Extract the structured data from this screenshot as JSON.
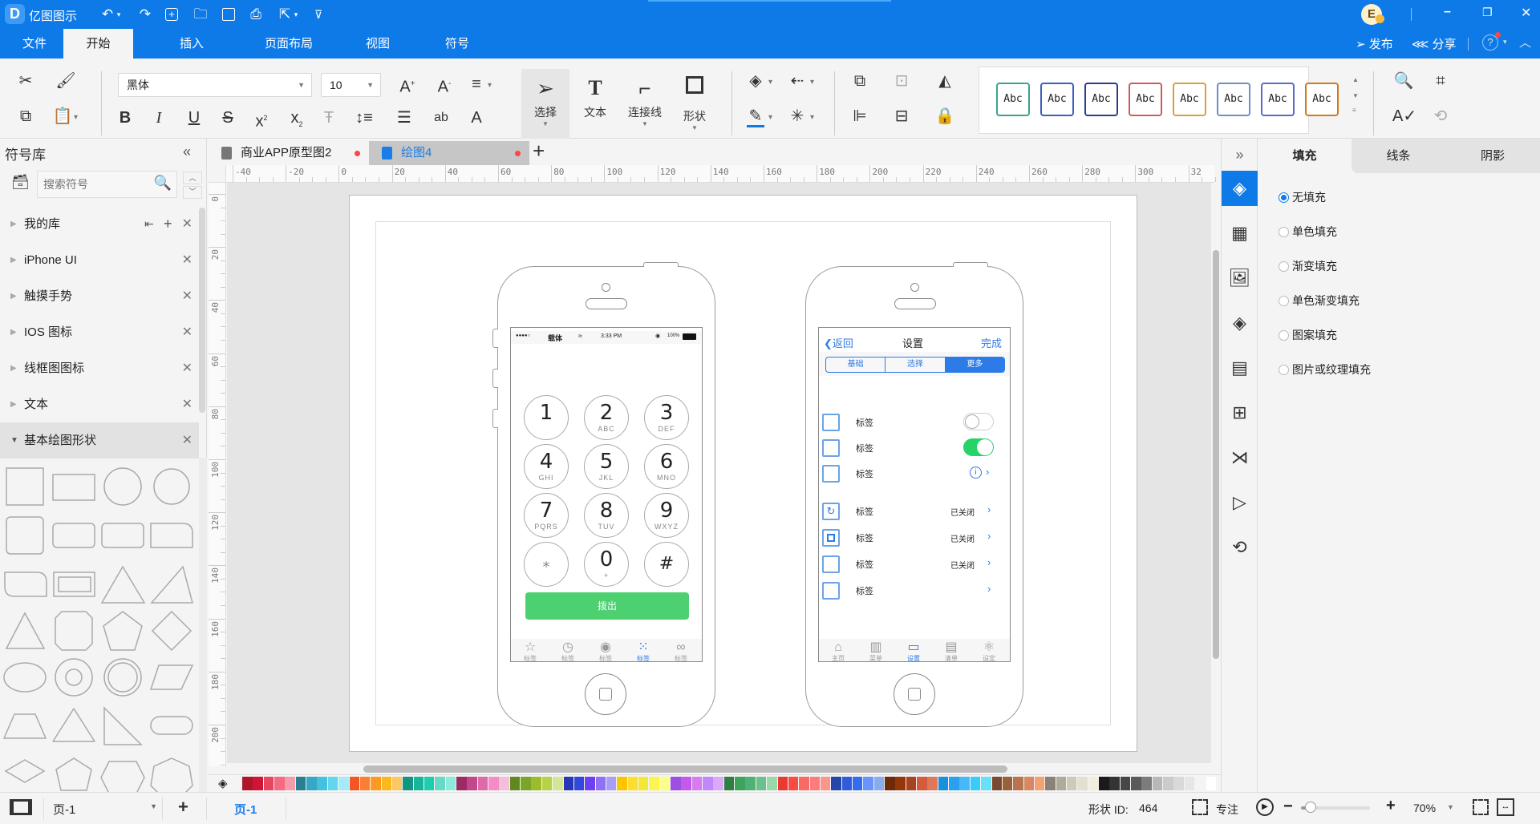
{
  "app": {
    "title": "亿图图示"
  },
  "quick_access": [
    "undo-icon",
    "redo-icon",
    "new-icon",
    "open-icon",
    "save-icon",
    "print-icon",
    "export-icon",
    "customize-icon"
  ],
  "window": {
    "avatar_letter": "E"
  },
  "menu": {
    "tabs": [
      {
        "label": "文件"
      },
      {
        "label": "开始",
        "active": true
      },
      {
        "label": "插入"
      },
      {
        "label": "页面布局"
      },
      {
        "label": "视图"
      },
      {
        "label": "符号"
      }
    ],
    "publish": "发布",
    "share": "分享"
  },
  "ribbon": {
    "font_family": "黑体",
    "font_size": "10",
    "tools": [
      {
        "label": "选择",
        "active": true
      },
      {
        "label": "文本"
      },
      {
        "label": "连接线"
      },
      {
        "label": "形状"
      }
    ],
    "style_swatch_text": "Abc",
    "style_swatches": [
      "#3aa38f",
      "#3a5fc2",
      "#2b3b8f",
      "#d05a5a",
      "#d8a23a",
      "#6b8fc8",
      "#5a6ac8",
      "#d07a1a"
    ]
  },
  "library": {
    "title": "符号库",
    "search_placeholder": "搜索符号",
    "items": [
      {
        "label": "我的库"
      },
      {
        "label": "iPhone UI"
      },
      {
        "label": "触摸手势"
      },
      {
        "label": "IOS 图标"
      },
      {
        "label": "线框图图标"
      },
      {
        "label": "文本"
      },
      {
        "label": "基本绘图形状",
        "expanded": true
      }
    ]
  },
  "doc_tabs": [
    {
      "label": "商业APP原型图2",
      "modified": true
    },
    {
      "label": "绘图4",
      "active": true,
      "modified": true
    }
  ],
  "ruler": {
    "h_ticks": [
      "-40",
      "-20",
      "0",
      "20",
      "40",
      "60",
      "80",
      "100",
      "120",
      "140",
      "160",
      "180",
      "200",
      "220",
      "240",
      "260",
      "280",
      "300",
      "32"
    ],
    "v_ticks": [
      "0",
      "20",
      "40",
      "60",
      "80",
      "100",
      "120",
      "140",
      "160",
      "180",
      "200"
    ]
  },
  "phone1": {
    "status": {
      "signal": "●●●●○",
      "carrier": "载体",
      "time": "3:33 PM",
      "battery": "100%"
    },
    "keys": [
      {
        "n": "1",
        "s": ""
      },
      {
        "n": "2",
        "s": "ABC"
      },
      {
        "n": "3",
        "s": "DEF"
      },
      {
        "n": "4",
        "s": "GHI"
      },
      {
        "n": "5",
        "s": "JKL"
      },
      {
        "n": "6",
        "s": "MNO"
      },
      {
        "n": "7",
        "s": "PQRS"
      },
      {
        "n": "8",
        "s": "TUV"
      },
      {
        "n": "9",
        "s": "WXYZ"
      },
      {
        "n": "*",
        "s": ""
      },
      {
        "n": "0",
        "s": "+"
      },
      {
        "n": "#",
        "s": ""
      }
    ],
    "call_button": "拨出",
    "call_color": "#4cd070",
    "tabbar": [
      {
        "icon": "star-icon",
        "label": "标签"
      },
      {
        "icon": "clock-icon",
        "label": "标签"
      },
      {
        "icon": "contact-icon",
        "label": "标签"
      },
      {
        "icon": "keypad-icon",
        "label": "标签",
        "active": true
      },
      {
        "icon": "voicemail-icon",
        "label": "标签"
      }
    ]
  },
  "phone2": {
    "nav": {
      "back": "返回",
      "title": "设置",
      "done": "完成"
    },
    "segments": [
      {
        "label": "基础"
      },
      {
        "label": "选择"
      },
      {
        "label": "更多",
        "active": true
      }
    ],
    "rows_a": [
      {
        "label": "标签",
        "accessory": "toggle-off"
      },
      {
        "label": "标签",
        "accessory": "toggle-on"
      },
      {
        "label": "标签",
        "accessory": "info"
      }
    ],
    "rows_b": [
      {
        "label": "标签",
        "value": "已关闭"
      },
      {
        "label": "标签",
        "value": "已关闭"
      },
      {
        "label": "标签",
        "value": "已关闭"
      },
      {
        "label": "标签",
        "value": ""
      }
    ],
    "tabbar": [
      {
        "icon": "home-icon",
        "label": "主页"
      },
      {
        "icon": "map-icon",
        "label": "菜单"
      },
      {
        "icon": "folder-icon",
        "label": "设置",
        "active": true
      },
      {
        "icon": "list-icon",
        "label": "清单"
      },
      {
        "icon": "atom-icon",
        "label": "设定"
      }
    ]
  },
  "palette": [
    "#b0162a",
    "#cf1438",
    "#e8465f",
    "#f26b82",
    "#f59bab",
    "#2a7f92",
    "#36a7c4",
    "#46c1dd",
    "#62d6ec",
    "#a8ebf8",
    "#f45426",
    "#fb7f32",
    "#fd9b20",
    "#ffb819",
    "#fcc862",
    "#129680",
    "#17b59b",
    "#20ccb0",
    "#6ad8c6",
    "#8deadc",
    "#9c2b63",
    "#c4468c",
    "#e06aa8",
    "#f58cc8",
    "#f2c0dc",
    "#62871b",
    "#7ba52a",
    "#9cbc2c",
    "#b6d24a",
    "#d5e495",
    "#2936b6",
    "#3447dc",
    "#7040f0",
    "#9070f5",
    "#a99ef5",
    "#fec400",
    "#fedd32",
    "#f1e934",
    "#fbf552",
    "#fdfd8a",
    "#9c4fe0",
    "#c45ae8",
    "#d67cf0",
    "#c088f8",
    "#dda8fb",
    "#2f7f45",
    "#3fa35b",
    "#50b075",
    "#6cc08c",
    "#98d8ab",
    "#e83a32",
    "#fa4b43",
    "#f96a66",
    "#fb7d7b",
    "#fb958e",
    "#2646a8",
    "#2f5cd8",
    "#346cf0",
    "#6a94f8",
    "#88acee",
    "#6c2a08",
    "#943608",
    "#a84222",
    "#d25c3c",
    "#e07858",
    "#1890da",
    "#2aa0f0",
    "#48b8f8",
    "#38ccf8",
    "#68e0f8",
    "#7a4a30",
    "#9a603a",
    "#b87452",
    "#d68862",
    "#f4a070",
    "#8a8278",
    "#b0aa98",
    "#cccab8",
    "#e4e0d0",
    "#f2eedc",
    "#1a1a1a",
    "#333333",
    "#474747",
    "#5a5a5a",
    "#7c7c7c",
    "#b8b8b8",
    "#cbcbcb",
    "#d9d9d9",
    "#e6e6e6",
    "#f4f4f4",
    "#ffffff"
  ],
  "right_panel": {
    "tabs": [
      {
        "label": "填充",
        "active": true
      },
      {
        "label": "线条"
      },
      {
        "label": "阴影"
      }
    ],
    "fill_options": [
      {
        "label": "无填充",
        "checked": true
      },
      {
        "label": "单色填充"
      },
      {
        "label": "渐变填充"
      },
      {
        "label": "单色渐变填充"
      },
      {
        "label": "图案填充"
      },
      {
        "label": "图片或纹理填充"
      }
    ]
  },
  "status": {
    "page_select": "页-1",
    "page_tab": "页-1",
    "shape_id_label": "形状 ID:",
    "shape_id": "464",
    "focus": "专注",
    "zoom": "70%",
    "zoom_fraction": 0.14
  },
  "colors": {
    "accent": "#0d7ae8"
  }
}
